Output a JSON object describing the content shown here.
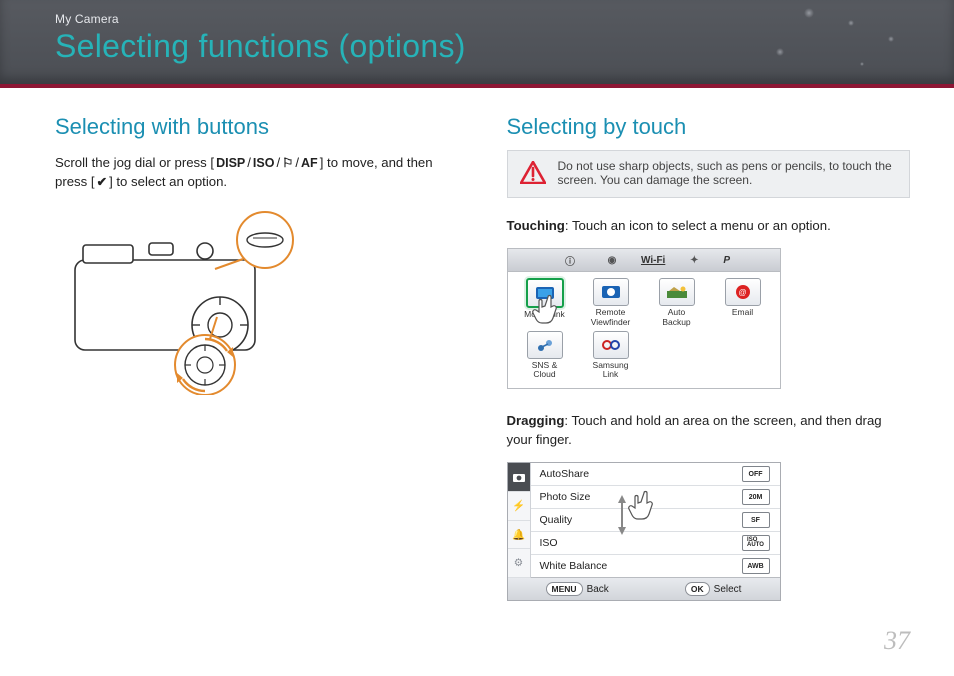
{
  "header": {
    "breadcrumb": "My Camera",
    "title": "Selecting functions (options)"
  },
  "left": {
    "heading": "Selecting with buttons",
    "body_pre": "Scroll the jog dial or press [",
    "icons": [
      "DISP",
      "ISO",
      "⚐",
      "AF"
    ],
    "body_mid": "] to move, and then press [",
    "ok_icon": "✔",
    "body_post": "] to select an option."
  },
  "right": {
    "heading": "Selecting by touch",
    "warning": "Do not use sharp objects, such as pens or pencils, to touch the screen. You can damage the screen.",
    "touching_label": "Touching",
    "touching_text": ": Touch an icon to select a menu or an option.",
    "topbar": {
      "wifi": "Wi-Fi",
      "p": "P"
    },
    "tiles": [
      {
        "key": "mobilelink",
        "label": "MobileLink",
        "selected": true
      },
      {
        "key": "remote",
        "label": "Remote\nViewfinder"
      },
      {
        "key": "autobackup",
        "label": "Auto\nBackup"
      },
      {
        "key": "email",
        "label": "Email"
      },
      {
        "key": "sns",
        "label": "SNS &\nCloud"
      },
      {
        "key": "samsunglink",
        "label": "Samsung\nLink"
      }
    ],
    "dragging_label": "Dragging",
    "dragging_text": ": Touch and hold an area on the screen, and then drag your finger.",
    "settings": {
      "rows": [
        {
          "name": "AutoShare",
          "value_icon": "OFF"
        },
        {
          "name": "Photo Size",
          "value_icon": "20M"
        },
        {
          "name": "Quality",
          "value_icon": "SF"
        },
        {
          "name": "ISO",
          "value_icon": "ISO\nAUTO"
        },
        {
          "name": "White Balance",
          "value_icon": "AWB"
        }
      ],
      "footer": {
        "back_key": "MENU",
        "back": "Back",
        "select_key": "OK",
        "select": "Select"
      }
    }
  },
  "page": "37"
}
